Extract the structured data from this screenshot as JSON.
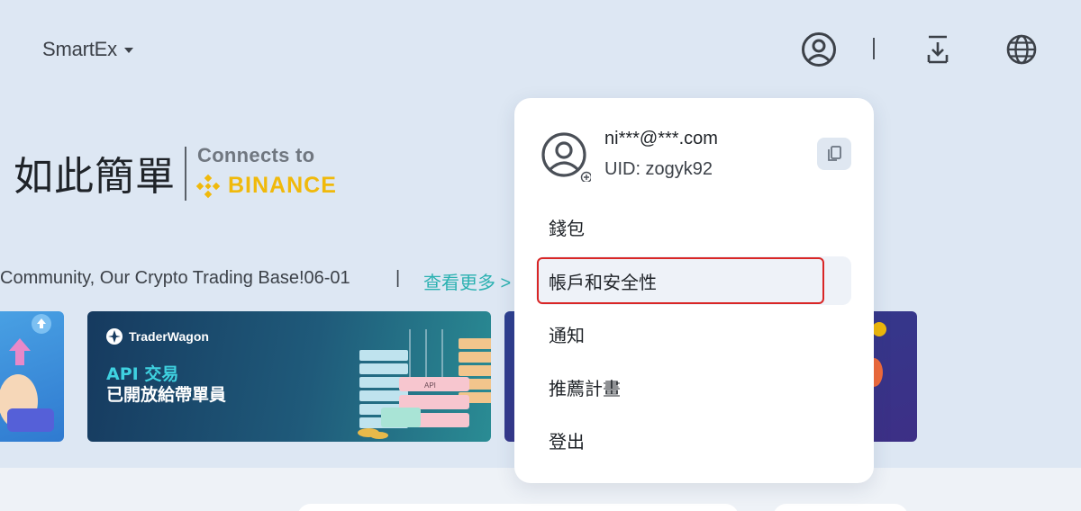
{
  "header": {
    "brand": "SmartEx",
    "icons": [
      "user-circle-icon",
      "download-icon",
      "globe-icon"
    ]
  },
  "hero": {
    "title": "如此簡單",
    "connects_to": "Connects to",
    "partner": "BINANCE"
  },
  "announcement": {
    "text": "Community, Our Crypto Trading Base!06-01",
    "separator": "|",
    "see_more": "查看更多 >"
  },
  "banner": {
    "brand": "TraderWagon",
    "line1": "API 交易",
    "line2": "已開放給帶單員",
    "server_label": "API"
  },
  "account_menu": {
    "email": "ni***@***.com",
    "uid": "UID: zogyk92",
    "items": [
      {
        "label": "錢包"
      },
      {
        "label": "帳戶和安全性"
      },
      {
        "label": "通知"
      },
      {
        "label": "推薦計畫"
      },
      {
        "label": "登出"
      }
    ],
    "active_index": 1
  },
  "colors": {
    "background": "#dde7f3",
    "accent": "#2bb1b1",
    "binance": "#f0b90b",
    "highlight": "#d92626"
  }
}
